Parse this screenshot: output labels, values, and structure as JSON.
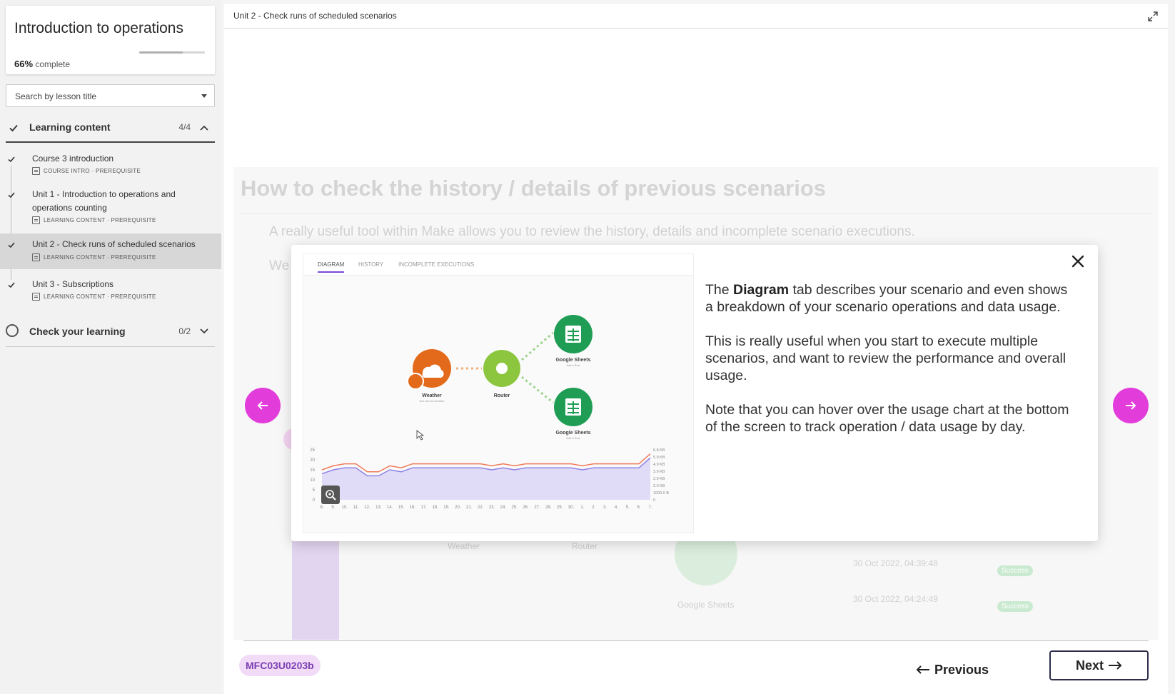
{
  "sidebar": {
    "course_title": "Introduction to operations",
    "progress_percent": 66,
    "progress_value": "66%",
    "progress_suffix": "complete",
    "search_placeholder": "Search by lesson title",
    "sections": [
      {
        "title": "Learning content",
        "count": "4/4",
        "lessons": [
          {
            "name": "Course 3 introduction",
            "meta": "COURSE INTRO · PREREQUISITE"
          },
          {
            "name": "Unit 1 - Introduction to operations and operations counting",
            "meta": "LEARNING CONTENT · PREREQUISITE"
          },
          {
            "name": "Unit 2 - Check runs of scheduled scenarios",
            "meta": "LEARNING CONTENT · PREREQUISITE"
          },
          {
            "name": "Unit 3 - Subscriptions",
            "meta": "LEARNING CONTENT · PREREQUISITE"
          }
        ]
      },
      {
        "title": "Check your learning",
        "count": "0/2"
      }
    ]
  },
  "main": {
    "breadcrumb": "Unit 2 - Check runs of scheduled scenarios",
    "background": {
      "heading": "How to check the history / details of previous scenarios",
      "paragraph": "A really useful tool within Make allows you to review the history, details and incomplete scenario executions.",
      "fragment": "We",
      "weather": "Weather",
      "router": "Router",
      "google_sheets": "Google Sheets",
      "history": [
        {
          "time": "30 Oct 2022, 04:39:48",
          "status": "Success"
        },
        {
          "time": "30 Oct 2022, 04:24:49",
          "status": "Success"
        }
      ]
    },
    "code_badge": "MFC03U0203b",
    "previous_label": "Previous",
    "next_label": "Next"
  },
  "modal": {
    "screenshot": {
      "tabs": [
        "DIAGRAM",
        "HISTORY",
        "INCOMPLETE EXECUTIONS"
      ],
      "nodes": {
        "weather": "Weather",
        "weather_sub": "Get current weather",
        "router": "Router",
        "sheets_1": "Google Sheets",
        "sheets_1_sub": "Add a Row",
        "sheets_2": "Google Sheets",
        "sheets_2_sub": "Add a Row"
      },
      "chart_data": {
        "type": "line",
        "x": [
          "8.",
          "9.",
          "10.",
          "11.",
          "12.",
          "13.",
          "14.",
          "15.",
          "16.",
          "17.",
          "18.",
          "19.",
          "20.",
          "21.",
          "22.",
          "23.",
          "24.",
          "25.",
          "26.",
          "27.",
          "28.",
          "29.",
          "30.",
          "1.",
          "2.",
          "3.",
          "4.",
          "5.",
          "6.",
          "7."
        ],
        "y_left_ticks": [
          "25",
          "20",
          "15",
          "10",
          "5",
          "0"
        ],
        "y_right_ticks": [
          "6.8 KB",
          "5.9 KB",
          "4.9 KB",
          "3.9 KB",
          "2.9 KB",
          "2.0 KB",
          "1000.0 B",
          "0"
        ],
        "ylim": [
          0,
          25
        ],
        "series": [
          {
            "color": "#f07a5a",
            "values": [
              15,
              17,
              18,
              18,
              14,
              14,
              17,
              16,
              18,
              18,
              18,
              18,
              18,
              18,
              18,
              17,
              18,
              17,
              18,
              18,
              18,
              18,
              18,
              17,
              18,
              18,
              18,
              18,
              18,
              23
            ]
          },
          {
            "color": "#8d82e6",
            "values": [
              13,
              15,
              16,
              16,
              12,
              12,
              15,
              14,
              16,
              16,
              16,
              16,
              16,
              16,
              16,
              15,
              16,
              15,
              16,
              16,
              16,
              16,
              16,
              15,
              16,
              16,
              16,
              16,
              16,
              21
            ]
          }
        ]
      }
    },
    "text": {
      "p1_before": "The ",
      "p1_bold": "Diagram",
      "p1_after": " tab describes your scenario and even shows a breakdown of your scenario operations and data usage.",
      "p2": "This is really useful when you start to execute multiple scenarios, and want to review the performance and overall usage.",
      "p3": "Note that you can hover over the usage chart at the bottom of the screen to track operation / data usage by day."
    }
  },
  "colors": {
    "accent": "#e23ddb",
    "badge_bg": "#f1dbf6",
    "badge_text": "#7b3fb2",
    "tab_underline": "#7a4bd6",
    "sheets_green": "#1f9d55",
    "router_green": "#8cc63f",
    "weather_orange": "#e36a1b"
  }
}
